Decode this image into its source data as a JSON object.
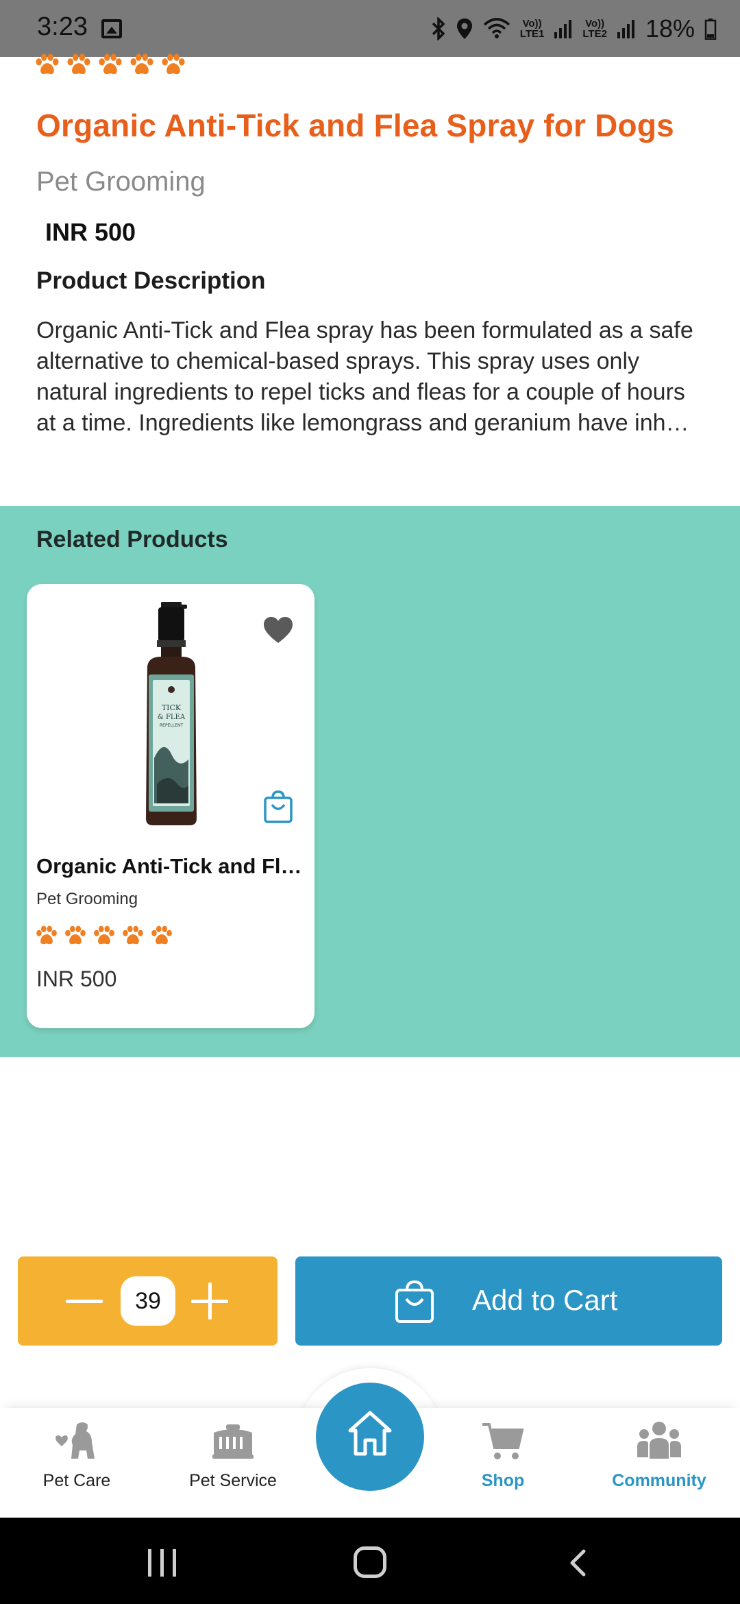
{
  "status_bar": {
    "time": "3:23",
    "battery": "18%",
    "lte1": "LTE1",
    "lte2": "LTE2",
    "volte": "Vo))"
  },
  "product": {
    "title": "Organic Anti-Tick and Flea Spray for Dogs",
    "category": "Pet Grooming",
    "price": "INR 500",
    "rating": 5,
    "description_heading": "Product Description",
    "description": "Organic Anti-Tick and Flea spray has been formulated as a safe alternative to chemical-based sprays. This spray uses only natural ingredients to repel ticks and fleas for a couple of hours at a time. Ingredients like lemongrass and geranium have inh…"
  },
  "related": {
    "heading": "Related Products",
    "items": [
      {
        "title": "Organic Anti-Tick and Fl…",
        "category": "Pet Grooming",
        "price": "INR 500",
        "rating": 5,
        "label_line1": "TICK",
        "label_line2": "& FLEA",
        "label_line3": "REPELLENT"
      }
    ]
  },
  "cart": {
    "quantity": "39",
    "add_label": "Add to Cart"
  },
  "nav": {
    "items": [
      {
        "label": "Pet Care",
        "icon": "pet-care-icon"
      },
      {
        "label": "Pet Service",
        "icon": "pet-carrier-icon"
      },
      {
        "label": "Home",
        "icon": "home-icon"
      },
      {
        "label": "Shop",
        "icon": "shopping-cart-icon"
      },
      {
        "label": "Community",
        "icon": "community-icon"
      }
    ]
  },
  "colors": {
    "accent_orange": "#e85f1b",
    "related_bg": "#7bd1bf",
    "qty_yellow": "#f5b232",
    "brand_blue": "#2b95c5"
  }
}
